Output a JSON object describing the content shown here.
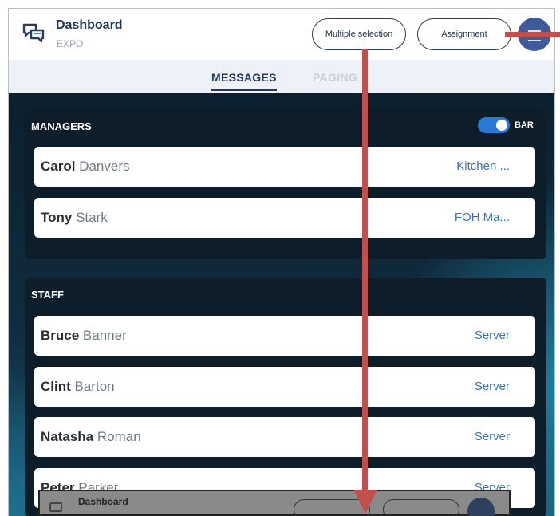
{
  "header": {
    "title": "Dashboard",
    "subtitle": "EXPO",
    "multiple_selection_label": "Multiple selection",
    "assignment_label": "Assignment",
    "menu_icon": "menu-icon",
    "logo_icon": "chat-bubbles-icon"
  },
  "tabs": [
    {
      "label": "MESSAGES",
      "active": true
    },
    {
      "label": "PAGING",
      "active": false
    }
  ],
  "managers": {
    "title": "MANAGERS",
    "toggle_label": "BAR",
    "toggle_on": true,
    "rows": [
      {
        "first": "Carol",
        "last": "Danvers",
        "role": "Kitchen ..."
      },
      {
        "first": "Tony",
        "last": "Stark",
        "role": "FOH Ma..."
      }
    ]
  },
  "staff": {
    "title": "STAFF",
    "rows": [
      {
        "first": "Bruce",
        "last": "Banner",
        "role": "Server"
      },
      {
        "first": "Clint",
        "last": "Barton",
        "role": "Server"
      },
      {
        "first": "Natasha",
        "last": "Roman",
        "role": "Server"
      },
      {
        "first": "Peter",
        "last": "Parker",
        "role": "Server"
      }
    ]
  },
  "preview": {
    "title": "Dashboard"
  },
  "colors": {
    "accent": "#2b79d6",
    "annotation_arrow": "#c0504d",
    "navy": "#22395b"
  }
}
